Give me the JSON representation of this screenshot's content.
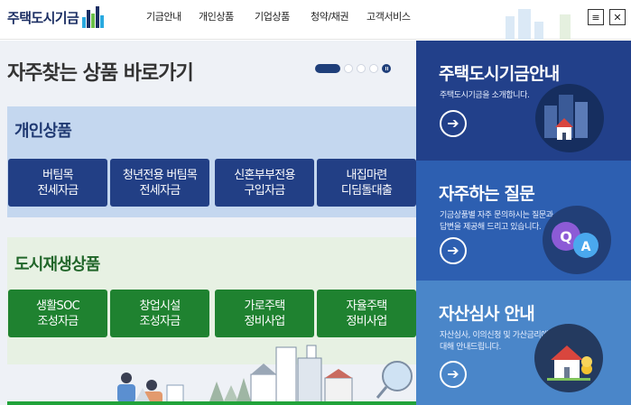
{
  "header": {
    "logo_text": "주택도시기금",
    "nav": [
      "기금안내",
      "개인상품",
      "기업상품",
      "청약/채권",
      "고객서비스"
    ],
    "menu_icon": "≡",
    "close_icon": "✕"
  },
  "main": {
    "title": "자주찾는 상품 바로가기",
    "slider": {
      "active_index": 1,
      "total": 4,
      "control_icon": "pause-icon"
    },
    "personal": {
      "label": "개인상품",
      "items": [
        "버팀목\n전세자금",
        "청년전용 버팀목\n전세자금",
        "신혼부부전용\n구입자금",
        "내집마련\n디딤돌대출"
      ]
    },
    "city": {
      "label": "도시재생상품",
      "items": [
        "생활SOC\n조성자금",
        "창업시설\n조성자금",
        "가로주택\n정비사업",
        "자율주택\n정비사업"
      ]
    }
  },
  "cards": [
    {
      "title": "주택도시기금안내",
      "desc": "주택도시기금을 소개합니다.",
      "arrow": "➔",
      "color": "#22408a"
    },
    {
      "title": "자주하는 질문",
      "desc": "기금상품별 자주 문의하시는 질문과\n답변을 제공해 드리고 있습니다.",
      "arrow": "➔",
      "color": "#2d5fb1"
    },
    {
      "title": "자산심사 안내",
      "desc": "자산심사, 이의신청 및 가산금리에\n대해 안내드립니다.",
      "arrow": "➔",
      "color": "#4a86c9"
    }
  ],
  "colors": {
    "brand_navy": "#1b2e63",
    "personal_tile": "#223f85",
    "city_tile": "#1f8230",
    "personal_bg": "#c4d7ef",
    "city_bg": "#e7f1e3"
  }
}
